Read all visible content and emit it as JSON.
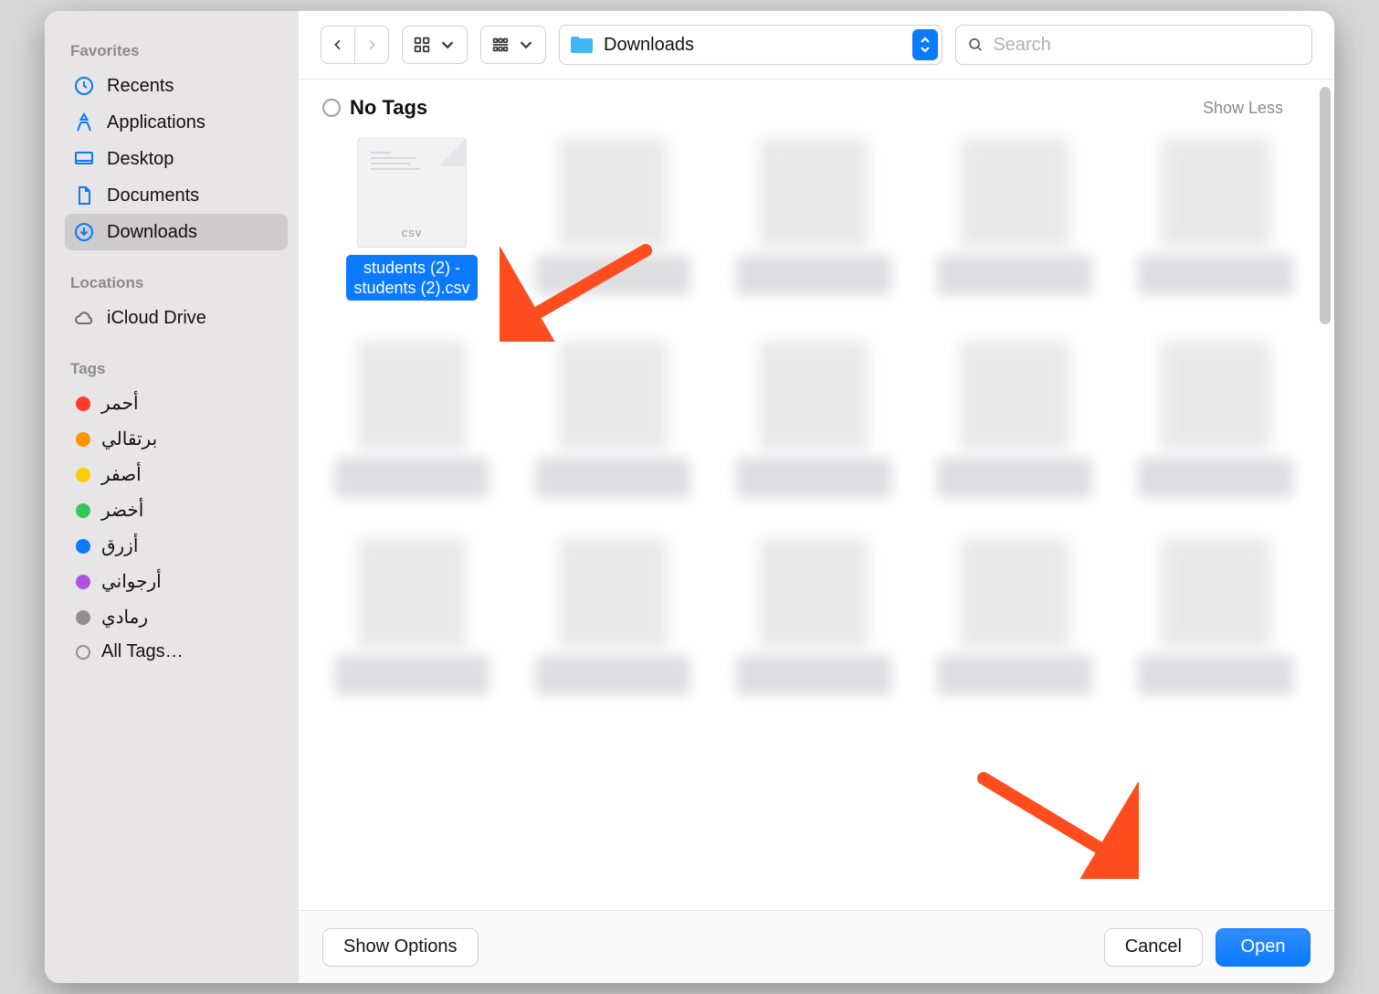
{
  "sidebar": {
    "sections": {
      "favorites": {
        "title": "Favorites"
      },
      "locations": {
        "title": "Locations"
      },
      "tags": {
        "title": "Tags"
      }
    },
    "favorites": [
      {
        "label": "Recents",
        "icon": "clock-icon"
      },
      {
        "label": "Applications",
        "icon": "app-icon"
      },
      {
        "label": "Desktop",
        "icon": "desktop-icon"
      },
      {
        "label": "Documents",
        "icon": "document-icon"
      },
      {
        "label": "Downloads",
        "icon": "download-icon",
        "selected": true
      }
    ],
    "locations": [
      {
        "label": "iCloud Drive",
        "icon": "cloud-icon"
      }
    ],
    "tags": [
      {
        "label": "أحمر",
        "color": "#ff3b30"
      },
      {
        "label": "برتقالي",
        "color": "#ff9500"
      },
      {
        "label": "أصفر",
        "color": "#ffcc00"
      },
      {
        "label": "أخضر",
        "color": "#34c759"
      },
      {
        "label": "أزرق",
        "color": "#0a7aff"
      },
      {
        "label": "أرجواني",
        "color": "#af52de"
      },
      {
        "label": "رمادي",
        "color": "#8e8e93"
      }
    ],
    "all_tags_label": "All Tags…"
  },
  "toolbar": {
    "location_label": "Downloads",
    "search_placeholder": "Search"
  },
  "content": {
    "group_title": "No Tags",
    "show_less_label": "Show Less",
    "selected_file": {
      "name_line1": "students (2) -",
      "name_line2": "students (2).csv",
      "badge": "csv"
    }
  },
  "footer": {
    "show_options_label": "Show Options",
    "cancel_label": "Cancel",
    "open_label": "Open"
  },
  "colors": {
    "accent": "#0a7aff"
  }
}
